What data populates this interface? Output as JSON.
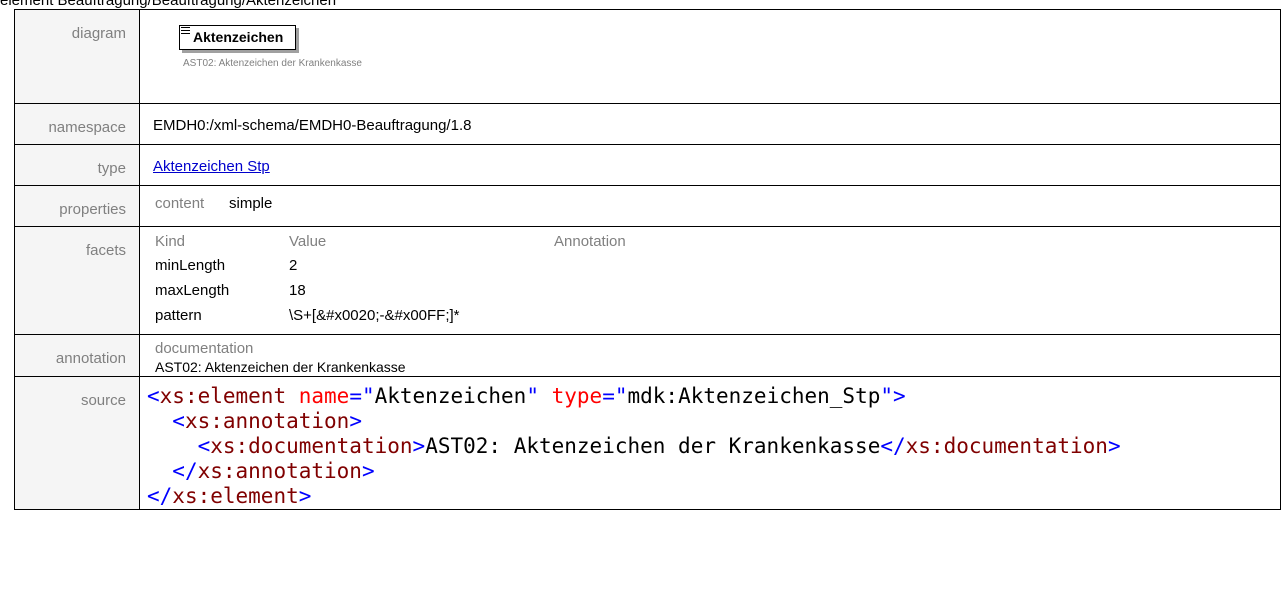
{
  "page_heading": "element Beauftragung/Beauftragung/Aktenzeichen",
  "rows": {
    "diagram_label": "diagram",
    "namespace_label": "namespace",
    "type_label": "type",
    "properties_label": "properties",
    "facets_label": "facets",
    "annotation_label": "annotation",
    "source_label": "source"
  },
  "diagram": {
    "element_name": "Aktenzeichen",
    "element_doc": "AST02: Aktenzeichen der Krankenkasse"
  },
  "namespace": "EMDH0:/xml-schema/EMDH0-Beauftragung/1.8",
  "type": "Aktenzeichen Stp",
  "properties": {
    "key": "content",
    "value": "simple"
  },
  "facets": {
    "headers": [
      "Kind",
      "Value",
      "Annotation"
    ],
    "items": [
      {
        "kind": "minLength",
        "value": "2",
        "annotation": ""
      },
      {
        "kind": "maxLength",
        "value": "18",
        "annotation": ""
      },
      {
        "kind": "pattern",
        "value": "\\S+[&#x0020;-&#x00FF;]*",
        "annotation": ""
      }
    ]
  },
  "annotation": {
    "label": "documentation",
    "text": "AST02: Aktenzeichen der Krankenkasse"
  },
  "source": {
    "l1_open": "<",
    "l1_tag": "xs:element",
    "l1_attr1": " name",
    "l1_eq1": "=\"",
    "l1_val1": "Aktenzeichen",
    "l1_q1": "\"",
    "l1_attr2": " type",
    "l1_eq2": "=\"",
    "l1_val2": "mdk:Aktenzeichen_Stp",
    "l1_close": "\">",
    "l2_tag": "xs:annotation",
    "l3_tag": "xs:documentation",
    "l3_text": "AST02: Aktenzeichen der Krankenkasse",
    "l3_endtag": "xs:documentation",
    "l4_endtag": "xs:annotation",
    "l5_endtag": "xs:element"
  }
}
